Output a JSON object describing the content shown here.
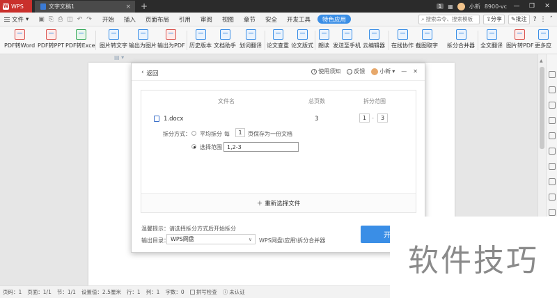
{
  "titlebar": {
    "app_name": "WPS",
    "doc_tab": "文字文稿1",
    "tab_add": "+",
    "badge": "1",
    "user": "小新",
    "account": "8900-vc"
  },
  "menubar": {
    "file": "文件",
    "items": [
      "开始",
      "插入",
      "页面布局",
      "引用",
      "审阅",
      "视图",
      "章节",
      "安全",
      "开发工具",
      "特色应用"
    ],
    "active_item": "特色应用",
    "search_placeholder": "搜索命令、搜索模板",
    "share": "分享",
    "comment": "批注"
  },
  "ribbon": {
    "buttons": [
      "PDF转Word",
      "PDF转PPT",
      "PDF转Excel",
      "图片转文字",
      "输出为图片",
      "输出为PDF",
      "历史版本",
      "文档助手",
      "划词翻译",
      "论文查重",
      "论文版式",
      "朗读",
      "发送至手机",
      "云编辑器",
      "在线协作",
      "截图取字",
      "拆分合并器",
      "全文翻译",
      "图片转PDF",
      "更多应"
    ]
  },
  "dialog": {
    "back": "返回",
    "help": "使用须知",
    "feedback": "反馈",
    "user": "小新",
    "col_filename": "文件名",
    "col_pages": "总页数",
    "col_range": "拆分范围",
    "file_name": "1.docx",
    "total_pages": "3",
    "range_from": "1",
    "range_dash": "-",
    "range_to": "3",
    "split_label": "拆分方式：",
    "opt_even": "平均拆分",
    "each": "每",
    "each_num": "1",
    "each_suffix": "页保存为一份文档",
    "opt_select": "选择范围",
    "select_value": "1,2-3",
    "add_file": "重新选择文件",
    "tip": "温馨提示：请选择拆分方式后开始拆分",
    "out_label": "输出目录：",
    "out_value": "WPS网盘",
    "out_path": "WPS网盘\\应用\\拆分合并器",
    "start": "开始"
  },
  "statusbar": {
    "page_no": "页码：1",
    "pages": "页面：1/1",
    "section": "节：1/1",
    "setting": "设置值：2.5厘米",
    "row": "行：1",
    "col": "列：1",
    "words": "字数：0",
    "spell": "拼写检查",
    "cert": "未认证"
  },
  "watermark": "软件技巧",
  "colors": {
    "accent": "#3a8ee6",
    "brand": "#c9302c"
  }
}
